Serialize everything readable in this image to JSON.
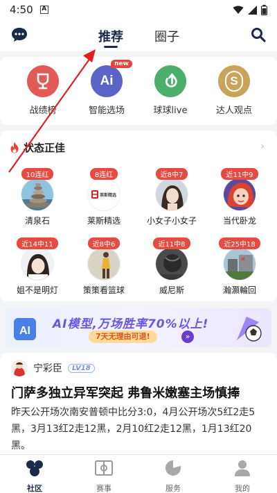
{
  "status_bar": {
    "time": "4:50",
    "a_icon_label": "A"
  },
  "top_nav": {
    "tabs": [
      {
        "label": "推荐",
        "active": true
      },
      {
        "label": "圈子",
        "active": false
      }
    ]
  },
  "quick_actions": [
    {
      "label": "战绩榜",
      "icon": "trophy-icon",
      "color": "#e25a55"
    },
    {
      "label": "智能选场",
      "icon": "ai-icon",
      "color": "#5a64c8",
      "badge": "new"
    },
    {
      "label": "球球live",
      "icon": "live-icon",
      "color": "#4cae6b"
    },
    {
      "label": "达人观点",
      "icon": "dollar-icon",
      "color": "#c9a35a"
    }
  ],
  "hot_section": {
    "title": "状态正佳",
    "experts": [
      {
        "badge": "10连红",
        "name": "清泉石"
      },
      {
        "badge": "8连红",
        "name": "莱斯精选"
      },
      {
        "badge": "近8中7",
        "name": "小女子小女子"
      },
      {
        "badge": "近11中9",
        "name": "当代卧龙"
      },
      {
        "badge": "近14中11",
        "name": "姐不是明灯"
      },
      {
        "badge": "近8中6",
        "name": "策策看篮球"
      },
      {
        "badge": "近11中8",
        "name": "威尼斯"
      },
      {
        "badge": "近25中18",
        "name": "瀚灝輪回"
      }
    ],
    "logo_text": "莱斯精选"
  },
  "banner": {
    "title": "AI模型,万场胜率70%以上!",
    "subtitle": "7天无理由可退!"
  },
  "article": {
    "author": "宁彩臣",
    "level": "LV18",
    "title": "门萨多独立异军突起 弗鲁米嫩塞主场慎捧",
    "body": "昨天公开场次南安普顿中比分3:0，4月公开场次5红2走5黑，3月13红2走12黑，2月10红2走12黑，1月13红20黑。"
  },
  "bottom_tabs": [
    {
      "label": "社区",
      "icon": "community-icon",
      "active": true
    },
    {
      "label": "赛事",
      "icon": "match-icon",
      "active": false
    },
    {
      "label": "服务",
      "icon": "service-icon",
      "active": false
    },
    {
      "label": "我的",
      "icon": "profile-icon",
      "active": false
    }
  ]
}
